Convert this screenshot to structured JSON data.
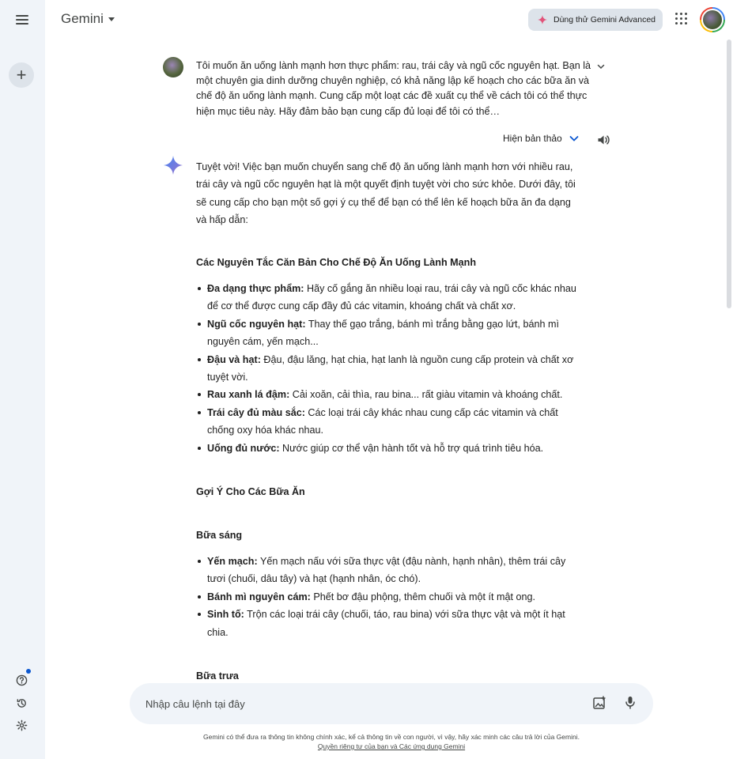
{
  "header": {
    "brand": "Gemini",
    "advanced_button": "Dùng thử Gemini Advanced"
  },
  "conversation": {
    "user_message": "Tôi muốn ăn uống lành mạnh hơn thực phẩm: rau, trái cây và ngũ cốc nguyên hạt. Bạn là một chuyên gia dinh dưỡng chuyên nghiệp, có khả năng lập kế hoạch cho các bữa ăn và chế độ ăn uống lành mạnh. Cung cấp một loạt các đề xuất cụ thể về cách tôi có thể thực hiện mục tiêu này. Hãy đảm bảo bạn cung cấp đủ loại để tôi có thể…",
    "draft_toggle": "Hiện bản thảo",
    "answer": {
      "intro": "Tuyệt vời! Việc bạn muốn chuyển sang chế độ ăn uống lành mạnh hơn với nhiều rau, trái cây và ngũ cốc nguyên hạt là một quyết định tuyệt vời cho sức khỏe. Dưới đây, tôi sẽ cung cấp cho bạn một số gợi ý cụ thể để bạn có thể lên kế hoạch bữa ăn đa dạng và hấp dẫn:",
      "section1_title": "Các Nguyên Tắc Căn Bản Cho Chế Độ Ăn Uống Lành Mạnh",
      "principles": [
        {
          "term": "Đa dạng thực phẩm:",
          "text": " Hãy cố gắng ăn nhiều loại rau, trái cây và ngũ cốc khác nhau để cơ thể được cung cấp đầy đủ các vitamin, khoáng chất và chất xơ."
        },
        {
          "term": "Ngũ cốc nguyên hạt:",
          "text": " Thay thế gạo trắng, bánh mì trắng bằng gạo lứt, bánh mì nguyên cám, yến mạch..."
        },
        {
          "term": "Đậu và hạt:",
          "text": " Đậu, đậu lăng, hạt chia, hạt lanh là nguồn cung cấp protein và chất xơ tuyệt vời."
        },
        {
          "term": "Rau xanh lá đậm:",
          "text": " Cải xoăn, cải thìa, rau bina... rất giàu vitamin và khoáng chất."
        },
        {
          "term": "Trái cây đủ màu sắc:",
          "text": " Các loại trái cây khác nhau cung cấp các vitamin và chất chống oxy hóa khác nhau."
        },
        {
          "term": "Uống đủ nước:",
          "text": " Nước giúp cơ thể vận hành tốt và hỗ trợ quá trình tiêu hóa."
        }
      ],
      "section2_title": "Gợi Ý Cho Các Bữa Ăn",
      "breakfast_title": "Bữa sáng",
      "breakfast": [
        {
          "term": "Yến mạch:",
          "text": " Yến mạch nấu với sữa thực vật (đậu nành, hạnh nhân), thêm trái cây tươi (chuối, dâu tây) và hạt (hạnh nhân, óc chó)."
        },
        {
          "term": "Bánh mì nguyên cám:",
          "text": " Phết bơ đậu phộng, thêm chuối và một ít mật ong."
        },
        {
          "term": "Sinh tố:",
          "text": " Trộn các loại trái cây (chuối, táo, rau bina) với sữa thực vật và một ít hạt chia."
        }
      ],
      "lunch_title": "Bữa trưa"
    }
  },
  "composer": {
    "placeholder": "Nhập câu lệnh tại đây"
  },
  "footer": {
    "disclaimer": "Gemini có thể đưa ra thông tin không chính xác, kể cả thông tin về con người, vì vậy, hãy xác minh các câu trả lời của Gemini.",
    "privacy_link": "Quyền riêng tư của bạn và Các ứng dụng Gemini"
  },
  "colors": {
    "rail_bg": "#f0f4f9",
    "button_bg": "#dde3ea",
    "accent_blue": "#0b57d0",
    "text": "#1f1f1f"
  },
  "icons": [
    "menu-icon",
    "plus-icon",
    "help-icon",
    "history-icon",
    "settings-icon",
    "sparkle-icon",
    "apps-grid-icon",
    "chevron-down-icon",
    "speaker-icon",
    "gemini-star-icon",
    "image-upload-icon",
    "microphone-icon"
  ]
}
